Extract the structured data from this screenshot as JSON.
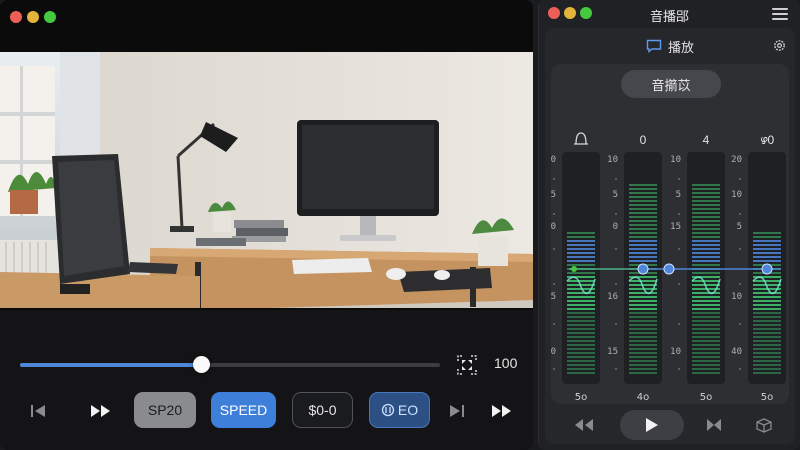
{
  "player": {
    "progress": 0.43,
    "volume_label": "100",
    "buttons": {
      "sp20": "SP20",
      "speed": "SPEED",
      "dollar": "$0-0",
      "eq": "EO"
    },
    "colors": {
      "accent": "#3e7fd9",
      "seek_fill": "#4f86d9"
    }
  },
  "mixer": {
    "title": "音播郘",
    "tab_label": "播放",
    "device_label": "音擶苡",
    "channels": [
      {
        "header": "",
        "header_icon": "bell-icon",
        "footer": "5o",
        "ticks": [
          "10",
          "5",
          "0",
          "5",
          "10"
        ],
        "level": 0.5
      },
      {
        "header": "0",
        "footer": "4o",
        "ticks": [
          "10",
          "5",
          "0",
          "16",
          "15"
        ],
        "level": 0.5
      },
      {
        "header": "4",
        "footer": "5o",
        "ticks": [
          "10",
          "5",
          "15",
          "",
          "10"
        ],
        "level": 0.5
      },
      {
        "header": "ഴ0",
        "footer": "5o",
        "ticks": [
          "20",
          "10",
          "5",
          "10",
          "40"
        ],
        "level": 0.5
      }
    ],
    "colors": {
      "meter_green": "#3fbf6e",
      "meter_blue": "#4f86d9",
      "center_line": "#4f86d9"
    }
  }
}
